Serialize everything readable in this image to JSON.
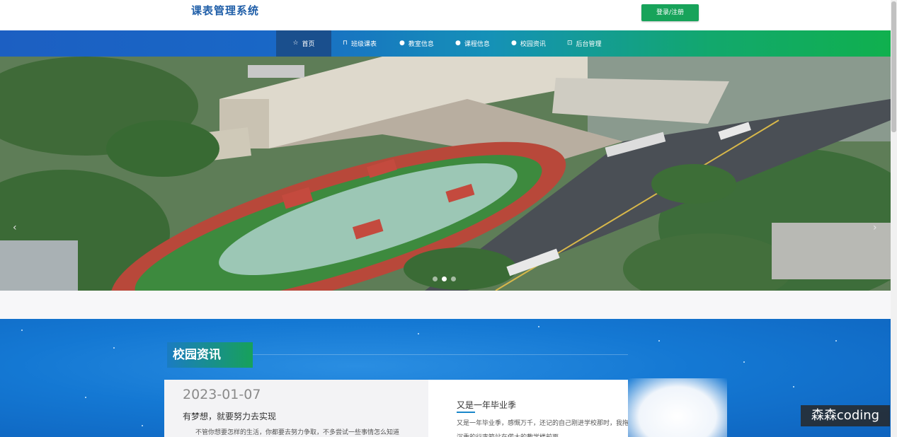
{
  "header": {
    "site_title": "课表管理系统",
    "login_label": "登录/注册"
  },
  "nav": {
    "items": [
      {
        "label": "首页",
        "icon": "star-icon",
        "active": true
      },
      {
        "label": "班级课表",
        "icon": "box-icon"
      },
      {
        "label": "教室信息",
        "icon": "circle-icon"
      },
      {
        "label": "课程信息",
        "icon": "circle-icon"
      },
      {
        "label": "校园资讯",
        "icon": "circle-icon"
      },
      {
        "label": "后台管理",
        "icon": "dashboard-icon"
      }
    ]
  },
  "carousel": {
    "prev": "‹",
    "next": "›",
    "slides": 3,
    "active_slide": 2
  },
  "news": {
    "heading": "校园资讯",
    "featured": {
      "date": "2023-01-07",
      "title": "有梦想，就要努力去实现",
      "excerpt": "不管你想要怎样的生活，你都要去努力争取，不多尝试一些事情怎么知道"
    },
    "second": {
      "title": "又是一年毕业季",
      "excerpt": "又是一年毕业季，感慨万千，还记的自己刚进学校那时，我拖着沉重的行李箱站在偌大的教学楼前面，"
    }
  },
  "watermark": "森森coding",
  "colors": {
    "brand_blue": "#1f5ea8",
    "login_green": "#17a35a",
    "nav_active": "#1a4f8d",
    "section_blue": "#1478d3"
  }
}
